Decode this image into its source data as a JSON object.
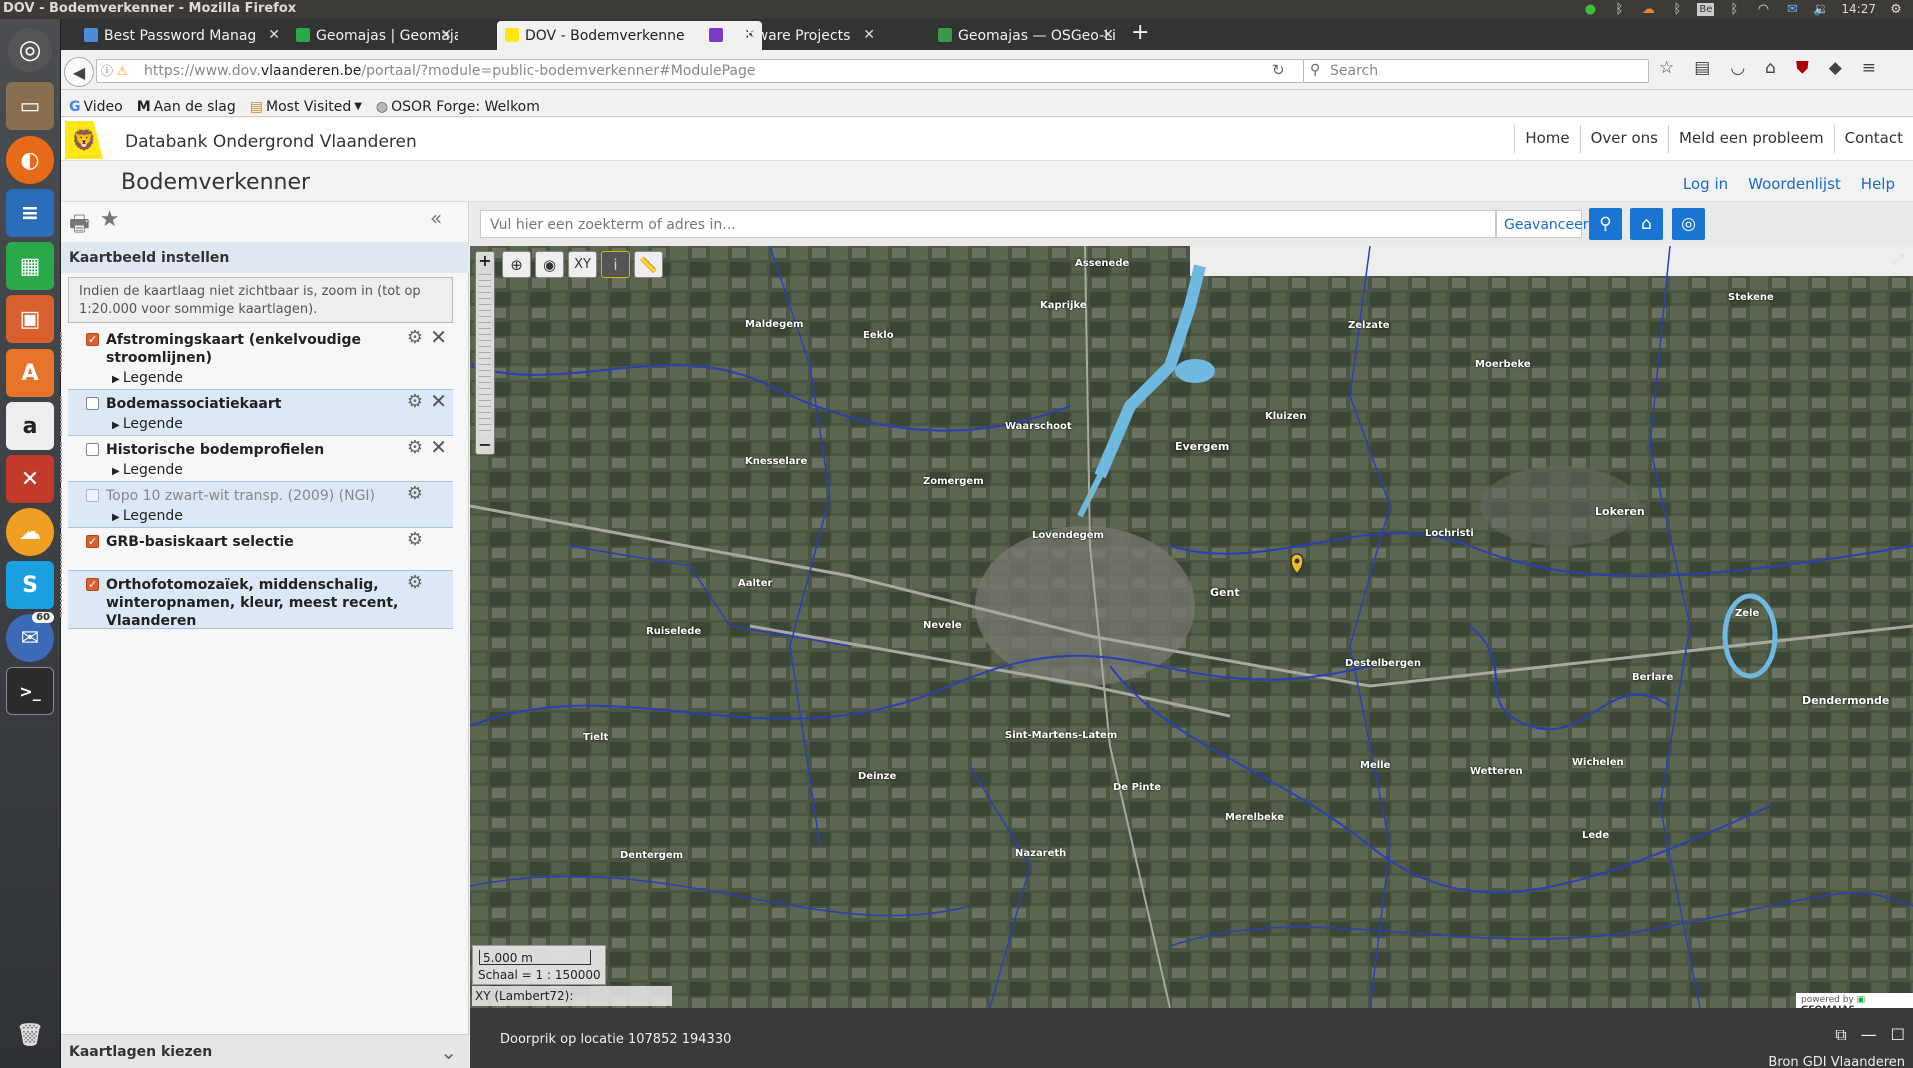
{
  "window": {
    "title": "DOV - Bodemverkenner - Mozilla Firefox",
    "time": "14:27",
    "keyboard": "Be"
  },
  "tabs": [
    {
      "label": "Best Password Manag",
      "icon": "lastpass-icon",
      "color": "#4a8cd6"
    },
    {
      "label": "Geomajas | Geomajas",
      "icon": "geomajas-icon",
      "color": "#2aa84a"
    },
    {
      "label": "DOV - Bodemverkenne",
      "icon": "flanders-icon",
      "color": "#ffe615"
    },
    {
      "label": "Software Projects",
      "icon": "list-icon",
      "color": "#7a3ac6"
    },
    {
      "label": "Geomajas — OSGeo-Li",
      "icon": "osgeo-icon",
      "color": "#3a9a4a"
    }
  ],
  "nav": {
    "url_prefix": "https://www.dov.",
    "url_domain": "vlaanderen.be",
    "url_rest": "/portaal/?module=public-bodemverkenner#ModulePage",
    "search_placeholder": "Search"
  },
  "bookmarks": [
    {
      "label": "Video",
      "icon": "google-icon",
      "glyph": "G"
    },
    {
      "label": "Aan de slag",
      "icon": "m-icon",
      "glyph": "M"
    },
    {
      "label": "Most Visited",
      "icon": "folder-icon",
      "glyph": "▤"
    },
    {
      "label": "OSOR Forge: Welkom",
      "icon": "osor-icon",
      "glyph": "◍"
    }
  ],
  "site": {
    "title": "Databank Ondergrond Vlaanderen",
    "links": [
      "Home",
      "Over ons",
      "Meld een probleem",
      "Contact"
    ],
    "app_title": "Bodemverkenner",
    "app_links": [
      "Log in",
      "Woordenlijst",
      "Help"
    ]
  },
  "left_panel": {
    "section_title": "Kaartbeeld instellen",
    "info": "Indien de kaartlaag niet zichtbaar is, zoom in (tot op 1:20.000 voor sommige kaartlagen).",
    "legend_label": "Legende",
    "layers": [
      {
        "name": "Afstromingskaart (enkelvoudige stroomlijnen)",
        "checked": true,
        "legend": true,
        "removable": true,
        "dim": false
      },
      {
        "name": "Bodemassociatiekaart",
        "checked": false,
        "legend": true,
        "removable": true,
        "dim": false
      },
      {
        "name": "Historische bodemprofielen",
        "checked": false,
        "legend": true,
        "removable": true,
        "dim": false
      },
      {
        "name": "Topo 10 zwart-wit transp. (2009) (NGI)",
        "checked": false,
        "legend": true,
        "removable": false,
        "dim": true
      },
      {
        "name": "GRB-basiskaart selectie",
        "checked": true,
        "legend": false,
        "removable": false,
        "dim": false
      },
      {
        "name": "Orthofotomozaïek, middenschalig, winteropnamen, kleur, meest recent, Vlaanderen",
        "checked": true,
        "legend": false,
        "removable": false,
        "dim": false
      }
    ],
    "bottom_title": "Kaartlagen kiezen"
  },
  "map": {
    "search_placeholder": "Vul hier een zoekterm of adres in...",
    "advanced_label": "Geavanceerd",
    "scale_bar": "5.000 m",
    "scale_text": "Schaal = 1 : 150000",
    "xy_label": "XY (Lambert72):",
    "powered_by": "powered by",
    "powered_brand": "GEOMAJAS",
    "toolbar_xy": "XY",
    "place_names": [
      "Assenede",
      "Kaprijke",
      "Zelzate",
      "Maldegem",
      "Eeklo",
      "Moerbeke",
      "Stekene",
      "Waarschoot",
      "Evergem",
      "Kluizen",
      "Knesselare",
      "Zomergem",
      "Lovendegem",
      "Lochristi",
      "Lokeren",
      "Gent",
      "Nevele",
      "Aalter",
      "Ruiselede",
      "Destelbergen",
      "Zele",
      "Berlare",
      "Dendermonde",
      "Sint-Martens-Latem",
      "Deinze",
      "De Pinte",
      "Melle",
      "Wetteren",
      "Wichelen",
      "Merelbeke",
      "Nazareth",
      "Tielt",
      "Dentergem",
      "Lede"
    ]
  },
  "status": {
    "text": "Doorprik op locatie 107852 194330",
    "source": "Bron GDI Vlaanderen"
  },
  "launcher_badge": "60"
}
